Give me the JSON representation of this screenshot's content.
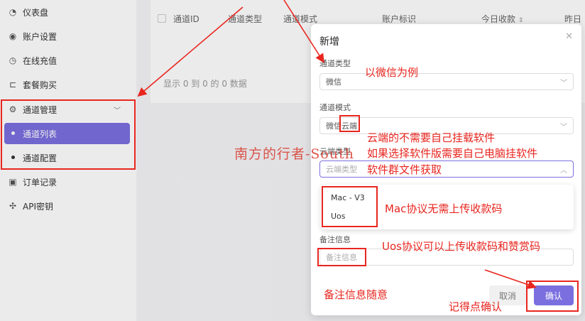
{
  "sidebar": {
    "items": [
      {
        "label": "仪表盘",
        "icon": "dashboard-icon"
      },
      {
        "label": "账户设置",
        "icon": "user-settings-icon"
      },
      {
        "label": "在线充值",
        "icon": "recharge-icon"
      },
      {
        "label": "套餐购买",
        "icon": "cart-icon"
      },
      {
        "label": "通道管理",
        "icon": "gear-icon"
      },
      {
        "label": "订单记录",
        "icon": "order-icon"
      },
      {
        "label": "API密钥",
        "icon": "api-key-icon"
      }
    ],
    "subitems": [
      {
        "label": "通道列表",
        "active": true
      },
      {
        "label": "通道配置",
        "active": false
      }
    ]
  },
  "table": {
    "headers": [
      "通道ID",
      "通道类型",
      "通道模式",
      "账户标识",
      "今日收款",
      "昨日收"
    ],
    "empty_text": "显示 0 到 0 的 0 数据"
  },
  "dialog": {
    "title": "新增",
    "fields": [
      {
        "label": "通道类型",
        "value": "微信"
      },
      {
        "label": "通道模式",
        "value": "微信云端"
      },
      {
        "label": "云端类型",
        "placeholder": "云端类型"
      },
      {
        "label": "备注信息",
        "placeholder": "备注信息"
      }
    ],
    "dropdown_options": [
      "Mac - V3",
      "Uos"
    ],
    "cancel_label": "取消",
    "confirm_label": "确认"
  },
  "annotations": [
    "以微信为例",
    "云端的不需要自己挂载软件",
    "如果选择软件版需要自己电脑挂软件",
    "软件群文件获取",
    "Mac协议无需上传收款码",
    "Uos协议可以上传收款码和赞赏码",
    "备注信息随意",
    "记得点确认"
  ],
  "watermark": "南方的行者-South",
  "colors": {
    "accent": "#7b6fe0",
    "annotation_red": "#e8261f"
  }
}
